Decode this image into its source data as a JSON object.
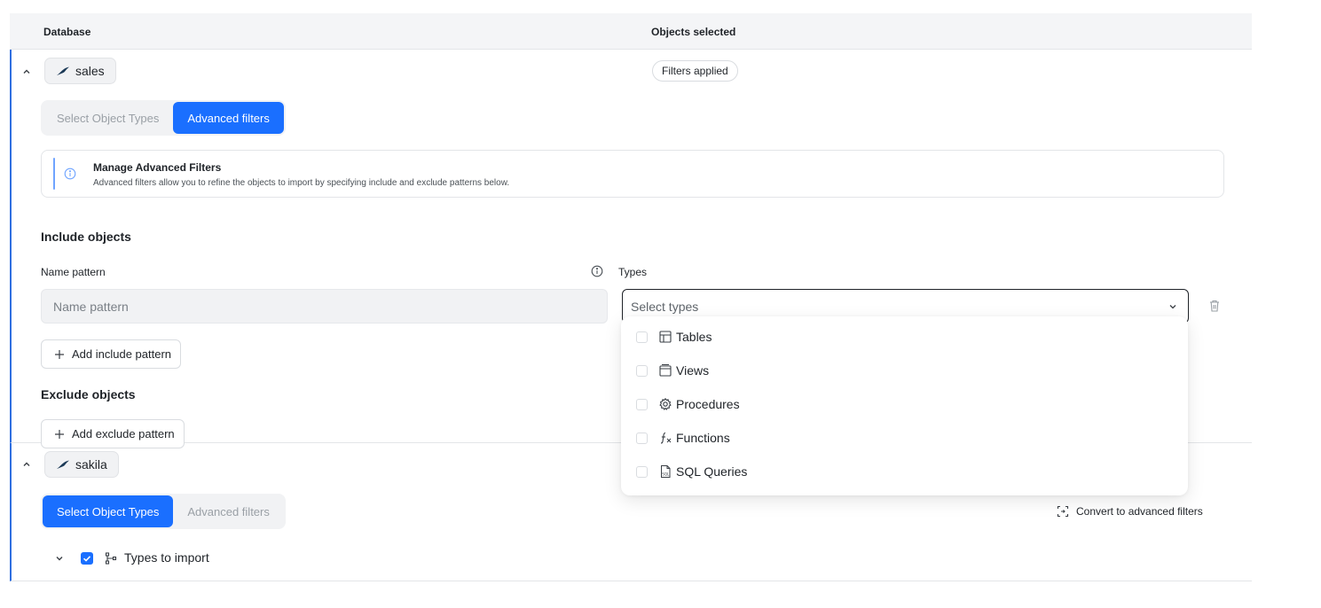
{
  "table_header": {
    "database_label": "Database",
    "objects_selected_label": "Objects selected"
  },
  "databases": [
    {
      "name": "sales",
      "status_pill": "Filters applied",
      "tabs": [
        "Select Object Types",
        "Advanced filters"
      ],
      "active_tab": "Advanced filters",
      "info": {
        "title": "Manage Advanced Filters",
        "description": "Advanced filters allow you to refine the objects to import by specifying include and exclude patterns below."
      },
      "include": {
        "heading": "Include objects",
        "name_pattern_label": "Name pattern",
        "name_pattern_placeholder": "Name pattern",
        "types_label": "Types",
        "types_placeholder": "Select types",
        "add_button": "Add include pattern"
      },
      "exclude": {
        "heading": "Exclude objects",
        "add_button": "Add exclude pattern"
      }
    },
    {
      "name": "sakila",
      "tabs": [
        "Select Object Types",
        "Advanced filters"
      ],
      "active_tab": "Select Object Types",
      "convert_button": "Convert to advanced filters",
      "tree_item": "Types to import"
    }
  ],
  "types_dropdown": {
    "options": [
      {
        "label": "Tables",
        "icon": "table-icon",
        "checked": false
      },
      {
        "label": "Views",
        "icon": "view-icon",
        "checked": false
      },
      {
        "label": "Procedures",
        "icon": "gear-icon",
        "checked": false
      },
      {
        "label": "Functions",
        "icon": "function-icon",
        "checked": false
      },
      {
        "label": "SQL Queries",
        "icon": "sql-file-icon",
        "checked": false
      }
    ]
  },
  "colors": {
    "accent": "#1a6fff",
    "section_border": "#2f6fe0",
    "info_accent": "#6fa4ff"
  }
}
